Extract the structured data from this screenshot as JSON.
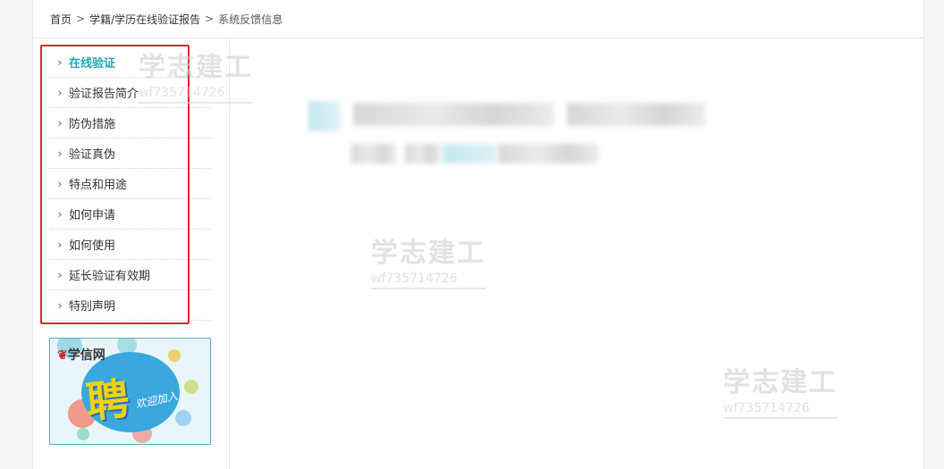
{
  "breadcrumb": {
    "home": "首页",
    "section": "学籍/学历在线验证报告",
    "current": "系统反馈信息",
    "separator": ">"
  },
  "sidebar": {
    "chevron": "›",
    "items": [
      {
        "label": "在线验证",
        "active": true
      },
      {
        "label": "验证报告简介",
        "active": false
      },
      {
        "label": "防伪措施",
        "active": false
      },
      {
        "label": "验证真伪",
        "active": false
      },
      {
        "label": "特点和用途",
        "active": false
      },
      {
        "label": "如何申请",
        "active": false
      },
      {
        "label": "如何使用",
        "active": false
      },
      {
        "label": "延长验证有效期",
        "active": false
      },
      {
        "label": "特别声明",
        "active": false
      }
    ]
  },
  "banner": {
    "logo": "学信网",
    "headline": "聘",
    "slogan": "欢迎加入"
  },
  "watermarks": [
    {
      "text": "学志建工",
      "id": "wf735714726"
    },
    {
      "text": "学志建工",
      "id": "wf735714726"
    },
    {
      "text": "学志建工",
      "id": "wf735714726"
    }
  ],
  "colors": {
    "accent": "#23a6b6",
    "highlight_border": "#e0262b",
    "banner_border": "#5ab0c0"
  }
}
